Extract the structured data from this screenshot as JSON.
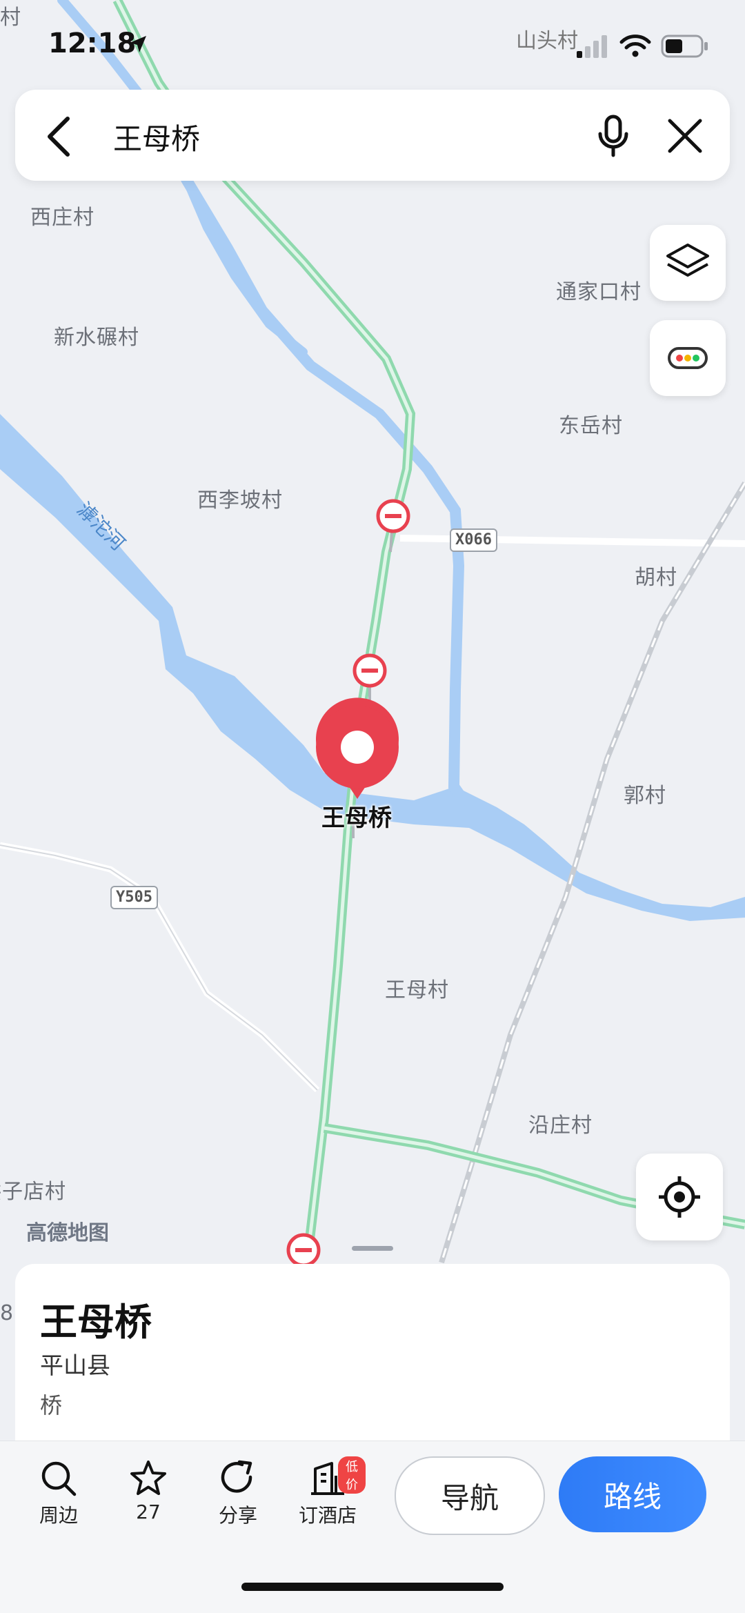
{
  "status_bar": {
    "time": "12:18",
    "location": "山头村"
  },
  "search": {
    "query": "王母桥"
  },
  "map": {
    "places": [
      "村",
      "西庄村",
      "新水碾村",
      "通家口村",
      "东岳村",
      "西李坡村",
      "胡村",
      "郭村",
      "王母村",
      "沿庄村",
      "洪子店村"
    ],
    "river": "滹沱河",
    "roads": [
      "X066",
      "Y505"
    ],
    "pin_label": "王母桥",
    "watermark": "高德地图",
    "edge_digit": "8"
  },
  "place_card": {
    "title": "王母桥",
    "district": "平山县",
    "type": "桥"
  },
  "toolbar": {
    "items": [
      {
        "label": "周边",
        "icon": "search-icon"
      },
      {
        "label": "27",
        "icon": "star-icon"
      },
      {
        "label": "分享",
        "icon": "share-icon"
      },
      {
        "label": "订酒店",
        "icon": "hotel-icon",
        "badge": "低价"
      }
    ],
    "nav_label": "导航",
    "route_label": "路线"
  },
  "colors": {
    "water": "#a9cdf5",
    "road_green": "#9fe3bd",
    "pin": "#e8414f",
    "accent": "#3388ff"
  }
}
